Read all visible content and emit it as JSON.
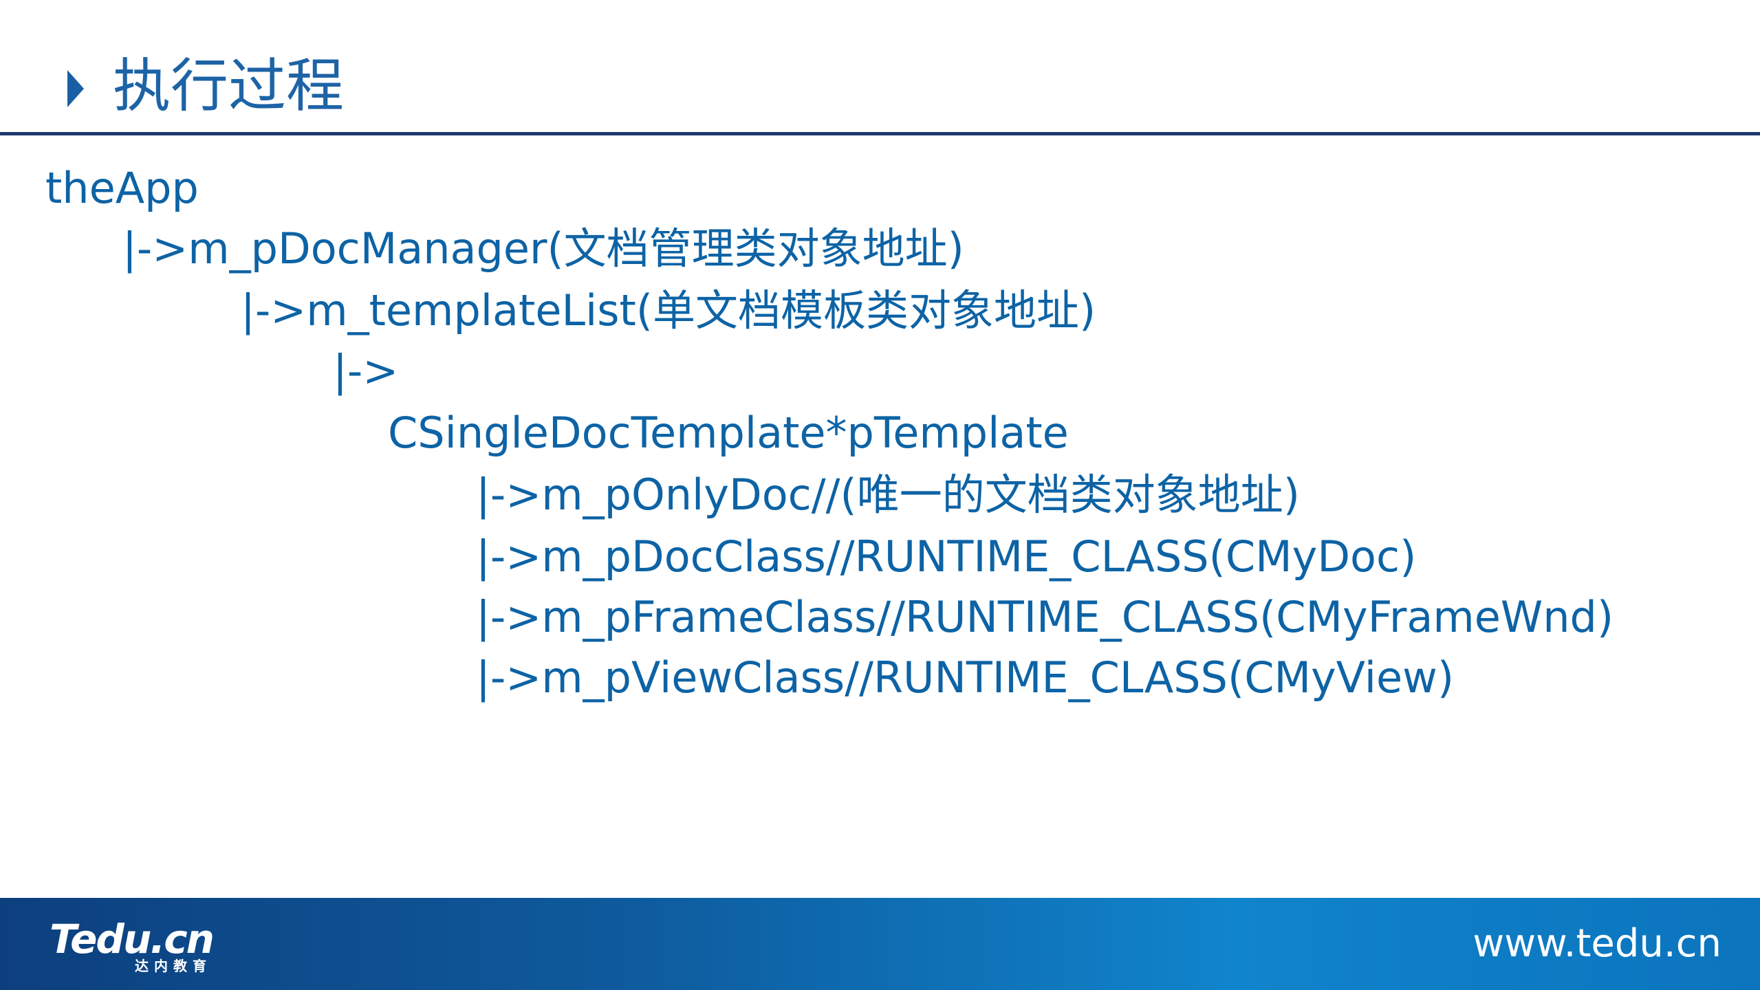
{
  "slide": {
    "title": "执行过程"
  },
  "content": {
    "lines": [
      "theApp",
      "|->m_pDocManager(文档管理类对象地址)",
      "|->m_templateList(单文档模板类对象地址)",
      "|->",
      "CSingleDocTemplate*pTemplate",
      "|->m_pOnlyDoc//(唯一的文档类对象地址)",
      "|->m_pDocClass//RUNTIME_CLASS(CMyDoc)",
      "|->m_pFrameClass//RUNTIME_CLASS(CMyFrameWnd)",
      "|->m_pViewClass//RUNTIME_CLASS(CMyView)"
    ]
  },
  "footer": {
    "logo_text": "Tedu.cn",
    "logo_subtitle": "达内教育",
    "url": "www.tedu.cn"
  },
  "colors": {
    "accent": "#0d63a5",
    "rule": "#1f3a70",
    "footer_start": "#0d3f7e",
    "footer_end": "#0b74bd"
  },
  "icons": {
    "title_marker": "triangle-right-icon"
  }
}
